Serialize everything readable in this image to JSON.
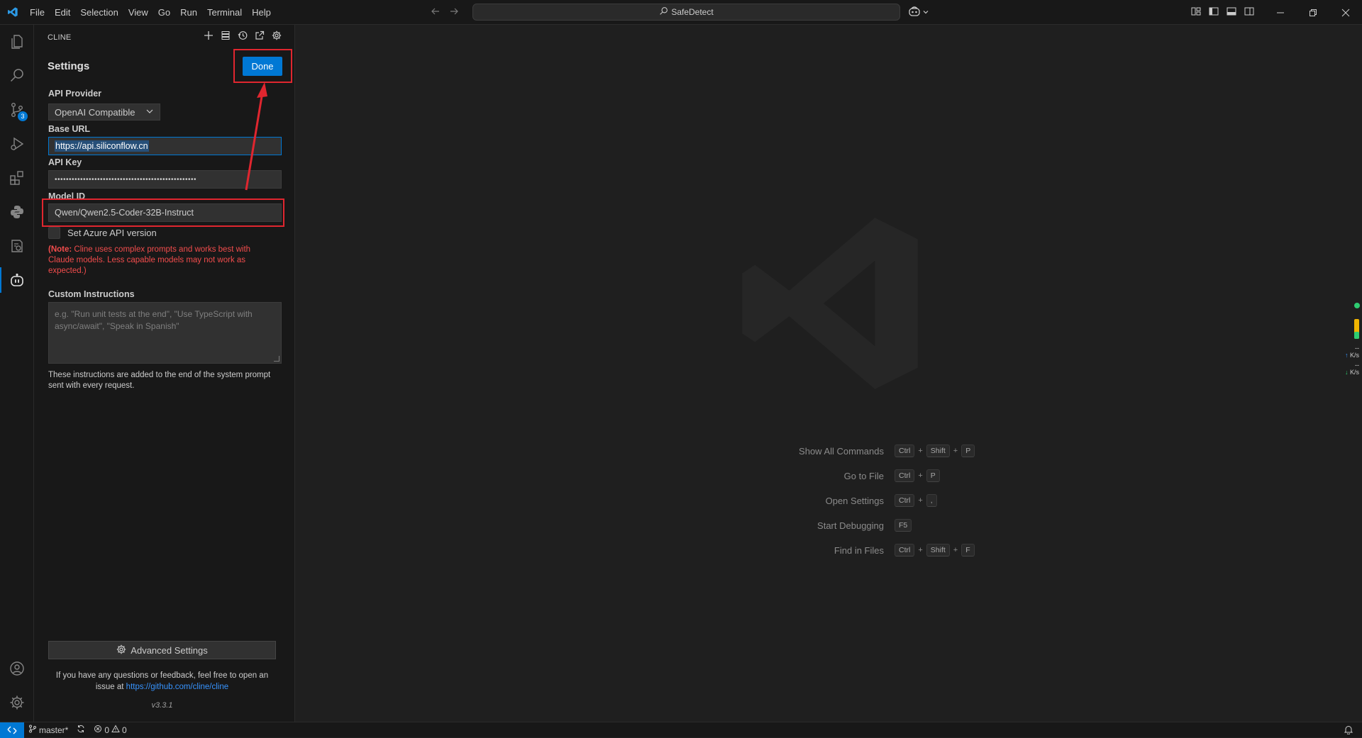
{
  "titlebar": {
    "menu": [
      "File",
      "Edit",
      "Selection",
      "View",
      "Go",
      "Run",
      "Terminal",
      "Help"
    ],
    "search_text": "SafeDetect"
  },
  "activitybar": {
    "scm_badge": "3"
  },
  "sidebar": {
    "panel_title": "CLINE",
    "settings_title": "Settings",
    "done_label": "Done",
    "api_provider_label": "API Provider",
    "api_provider_value": "OpenAI Compatible",
    "base_url_label": "Base URL",
    "base_url_value": "https://api.siliconflow.cn",
    "api_key_label": "API Key",
    "api_key_value": "••••••••••••••••••••••••••••••••••••••••••••••••••",
    "model_id_label": "Model ID",
    "model_id_value": "Qwen/Qwen2.5-Coder-32B-Instruct",
    "azure_label": "Set Azure API version",
    "note_prefix": "(Note:",
    "note_text": " Cline uses complex prompts and works best with Claude models. Less capable models may not work as expected.)",
    "custom_instructions_label": "Custom Instructions",
    "custom_instructions_placeholder": "e.g. \"Run unit tests at the end\", \"Use TypeScript with async/await\", \"Speak in Spanish\"",
    "custom_instructions_help": "These instructions are added to the end of the system prompt sent with every request.",
    "advanced_label": "Advanced Settings",
    "feedback_text": "If you have any questions or feedback, feel free to open an issue at ",
    "feedback_link": "https://github.com/cline/cline",
    "version": "v3.3.1"
  },
  "editor": {
    "shortcuts": [
      {
        "label": "Show All Commands",
        "keys": [
          "Ctrl",
          "+",
          "Shift",
          "+",
          "P"
        ]
      },
      {
        "label": "Go to File",
        "keys": [
          "Ctrl",
          "+",
          "P"
        ]
      },
      {
        "label": "Open Settings",
        "keys": [
          "Ctrl",
          "+",
          ","
        ]
      },
      {
        "label": "Start Debugging",
        "keys": [
          "F5"
        ]
      },
      {
        "label": "Find in Files",
        "keys": [
          "Ctrl",
          "+",
          "Shift",
          "+",
          "F"
        ]
      }
    ],
    "net_up": "--",
    "net_up_unit": "K/s",
    "net_down": "--",
    "net_down_unit": "K/s"
  },
  "statusbar": {
    "branch": "master*",
    "errors": "0",
    "warnings": "0"
  },
  "colors": {
    "accent": "#0078d4",
    "annotation_red": "#e0262f",
    "note_red": "#f14c4c"
  }
}
